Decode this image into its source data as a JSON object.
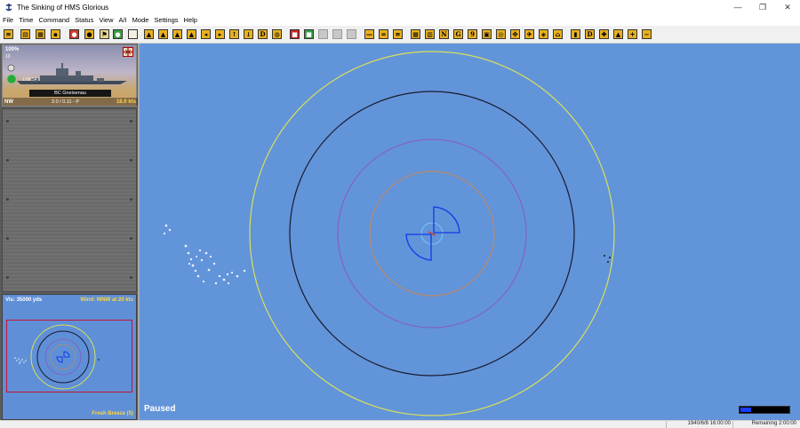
{
  "window": {
    "title": "The Sinking of HMS Glorious",
    "minimize": "—",
    "restore": "❐",
    "close": "✕"
  },
  "menu": [
    "File",
    "Time",
    "Command",
    "Status",
    "View",
    "A/I",
    "Mode",
    "Settings",
    "Help"
  ],
  "toolbar": {
    "letters": {
      "d": "D",
      "n": "N",
      "g": "G",
      "nine": "9",
      "d2": "D"
    }
  },
  "ship_card": {
    "health": "100%",
    "subline": "10",
    "time": "1:08:54",
    "name": "BC Gneisenau",
    "heading": "NW",
    "position": "3.0 / 0.11 - P",
    "speed": "18.0 kts"
  },
  "minimap": {
    "visibility": "Vis: 35000 yds",
    "wind": "Wind: WNW at 20 kts",
    "sea_state": "Fresh Breeze (5)"
  },
  "main": {
    "status": "Paused",
    "zoom_level": 0.22
  },
  "statusbar": {
    "datetime": "1940/6/8 16:00:00",
    "remaining": "Remaining 2:00:00"
  },
  "colors": {
    "sea": "#6294d9",
    "ring_outer": "#d8e05a",
    "ring_black": "#1a1a2e",
    "ring_purple": "#8a5ab8",
    "ring_orange": "#b98a6a",
    "arc_blue": "#1238e6",
    "frame_red": "#c41232",
    "label_yellow": "#ffd642"
  }
}
